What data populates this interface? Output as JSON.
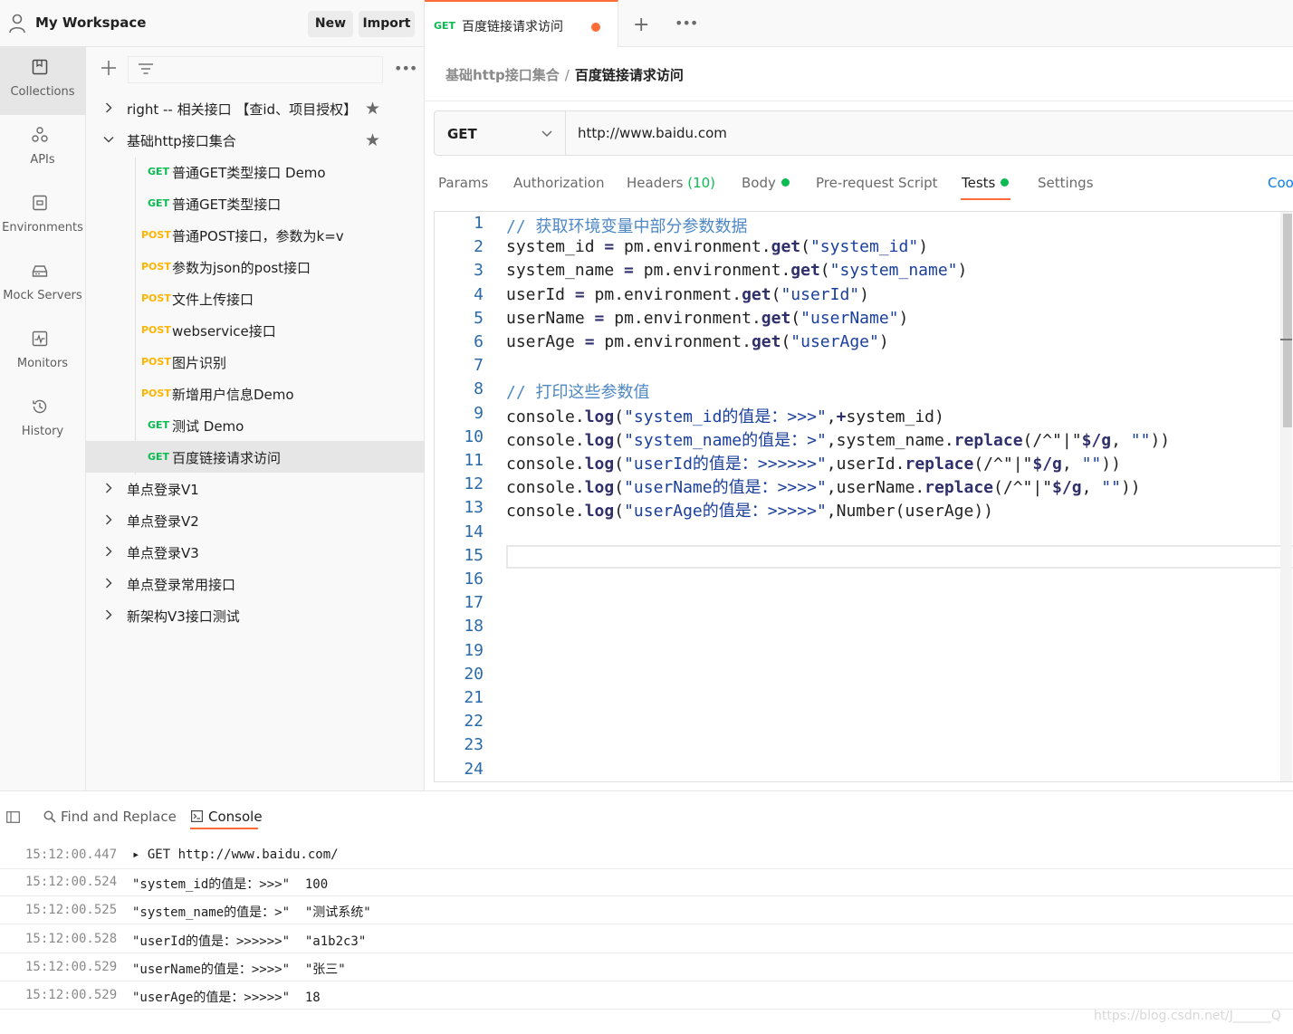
{
  "workspace": {
    "title": "My Workspace",
    "new_label": "New",
    "import_label": "Import"
  },
  "rail": [
    {
      "label": "Collections",
      "icon": "collections-icon",
      "active": true
    },
    {
      "label": "APIs",
      "icon": "apis-icon"
    },
    {
      "label": "Environments",
      "icon": "environments-icon"
    },
    {
      "label": "Mock Servers",
      "icon": "mock-servers-icon"
    },
    {
      "label": "Monitors",
      "icon": "monitors-icon"
    },
    {
      "label": "History",
      "icon": "history-icon"
    }
  ],
  "tree": {
    "items": [
      {
        "type": "folder",
        "label": "right -- 相关接口 【查id、项目授权】",
        "expanded": false,
        "starred": true
      },
      {
        "type": "folder",
        "label": "基础http接口集合",
        "expanded": true,
        "starred": true
      },
      {
        "type": "request",
        "method": "GET",
        "label": "普通GET类型接口 Demo"
      },
      {
        "type": "request",
        "method": "GET",
        "label": "普通GET类型接口"
      },
      {
        "type": "request",
        "method": "POST",
        "label": "普通POST接口，参数为k=v"
      },
      {
        "type": "request",
        "method": "POST",
        "label": "参数为json的post接口"
      },
      {
        "type": "request",
        "method": "POST",
        "label": "文件上传接口"
      },
      {
        "type": "request",
        "method": "POST",
        "label": "webservice接口"
      },
      {
        "type": "request",
        "method": "POST",
        "label": "图片识别"
      },
      {
        "type": "request",
        "method": "POST",
        "label": "新增用户信息Demo"
      },
      {
        "type": "request",
        "method": "GET",
        "label": "测试 Demo"
      },
      {
        "type": "request",
        "method": "GET",
        "label": "百度链接请求访问",
        "selected": true
      },
      {
        "type": "folder",
        "label": "单点登录V1",
        "expanded": false
      },
      {
        "type": "folder",
        "label": "单点登录V2",
        "expanded": false
      },
      {
        "type": "folder",
        "label": "单点登录V3",
        "expanded": false
      },
      {
        "type": "folder",
        "label": "单点登录常用接口",
        "expanded": false
      },
      {
        "type": "folder",
        "label": "新架构V3接口测试",
        "expanded": false
      }
    ]
  },
  "tab": {
    "method": "GET",
    "title": "百度链接请求访问",
    "unsaved": true
  },
  "breadcrumb": {
    "parent": "基础http接口集合",
    "separator": "/",
    "current": "百度链接请求访问"
  },
  "request": {
    "method": "GET",
    "url": "http://www.baidu.com"
  },
  "request_tabs": {
    "params": "Params",
    "authorization": "Authorization",
    "headers": "Headers",
    "headers_count": "(10)",
    "body": "Body",
    "pre_request": "Pre-request Script",
    "tests": "Tests",
    "settings": "Settings",
    "cookies": "Coo",
    "active": "Tests"
  },
  "editor": {
    "line_numbers": [
      "1",
      "2",
      "3",
      "4",
      "5",
      "6",
      "7",
      "8",
      "9",
      "10",
      "11",
      "12",
      "13",
      "14",
      "15",
      "16",
      "17",
      "18",
      "19",
      "20",
      "21",
      "22",
      "23",
      "24"
    ],
    "lines": [
      [
        [
          "cm",
          "// 获取环境变量中部分参数数据"
        ]
      ],
      [
        [
          "id",
          "system_id "
        ],
        [
          "kw",
          "="
        ],
        [
          "id",
          " pm.environment."
        ],
        [
          "kw",
          "get"
        ],
        [
          "id",
          "("
        ],
        [
          "str",
          "\"system_id\""
        ],
        [
          "id",
          ")"
        ]
      ],
      [
        [
          "id",
          "system_name "
        ],
        [
          "kw",
          "="
        ],
        [
          "id",
          " pm.environment."
        ],
        [
          "kw",
          "get"
        ],
        [
          "id",
          "("
        ],
        [
          "str",
          "\"system_name\""
        ],
        [
          "id",
          ")"
        ]
      ],
      [
        [
          "id",
          "userId "
        ],
        [
          "kw",
          "="
        ],
        [
          "id",
          " pm.environment."
        ],
        [
          "kw",
          "get"
        ],
        [
          "id",
          "("
        ],
        [
          "str",
          "\"userId\""
        ],
        [
          "id",
          ")"
        ]
      ],
      [
        [
          "id",
          "userName "
        ],
        [
          "kw",
          "="
        ],
        [
          "id",
          " pm.environment."
        ],
        [
          "kw",
          "get"
        ],
        [
          "id",
          "("
        ],
        [
          "str",
          "\"userName\""
        ],
        [
          "id",
          ")"
        ]
      ],
      [
        [
          "id",
          "userAge "
        ],
        [
          "kw",
          "="
        ],
        [
          "id",
          " pm.environment."
        ],
        [
          "kw",
          "get"
        ],
        [
          "id",
          "("
        ],
        [
          "str",
          "\"userAge\""
        ],
        [
          "id",
          ")"
        ]
      ],
      [],
      [
        [
          "cm",
          "// 打印这些参数值"
        ]
      ],
      [
        [
          "id",
          "console."
        ],
        [
          "kw",
          "log"
        ],
        [
          "id",
          "("
        ],
        [
          "str",
          "\"system_id的值是：>>>\""
        ],
        [
          "id",
          ","
        ],
        [
          "kw",
          "+"
        ],
        [
          "id",
          "system_id)"
        ]
      ],
      [
        [
          "id",
          "console."
        ],
        [
          "kw",
          "log"
        ],
        [
          "id",
          "("
        ],
        [
          "str",
          "\"system_name的值是：>\""
        ],
        [
          "id",
          ",system_name."
        ],
        [
          "kw",
          "replace"
        ],
        [
          "id",
          "(/^\"|\""
        ],
        [
          "kw",
          "$/g"
        ],
        [
          "id",
          ", "
        ],
        [
          "str",
          "\"\""
        ],
        [
          "id",
          "))"
        ]
      ],
      [
        [
          "id",
          "console."
        ],
        [
          "kw",
          "log"
        ],
        [
          "id",
          "("
        ],
        [
          "str",
          "\"userId的值是：>>>>>>\""
        ],
        [
          "id",
          ",userId."
        ],
        [
          "kw",
          "replace"
        ],
        [
          "id",
          "(/^\"|\""
        ],
        [
          "kw",
          "$/g"
        ],
        [
          "id",
          ", "
        ],
        [
          "str",
          "\"\""
        ],
        [
          "id",
          "))"
        ]
      ],
      [
        [
          "id",
          "console."
        ],
        [
          "kw",
          "log"
        ],
        [
          "id",
          "("
        ],
        [
          "str",
          "\"userName的值是：>>>>\""
        ],
        [
          "id",
          ",userName."
        ],
        [
          "kw",
          "replace"
        ],
        [
          "id",
          "(/^\"|\""
        ],
        [
          "kw",
          "$/g"
        ],
        [
          "id",
          ", "
        ],
        [
          "str",
          "\"\""
        ],
        [
          "id",
          "))"
        ]
      ],
      [
        [
          "id",
          "console."
        ],
        [
          "kw",
          "log"
        ],
        [
          "id",
          "("
        ],
        [
          "str",
          "\"userAge的值是：>>>>>\""
        ],
        [
          "id",
          ",Number(userAge))"
        ]
      ]
    ]
  },
  "console": {
    "find_replace": "Find and Replace",
    "console_label": "Console",
    "logs": [
      {
        "time": "15:12:00.447",
        "message": "▸ GET http://www.baidu.com/"
      },
      {
        "time": "15:12:00.524",
        "message": "\"system_id的值是：>>>\"  100"
      },
      {
        "time": "15:12:00.525",
        "message": "\"system_name的值是：>\"  \"测试系统\""
      },
      {
        "time": "15:12:00.528",
        "message": "\"userId的值是：>>>>>>\"  \"a1b2c3\""
      },
      {
        "time": "15:12:00.529",
        "message": "\"userName的值是：>>>>\"  \"张三\""
      },
      {
        "time": "15:12:00.529",
        "message": "\"userAge的值是：>>>>>\"  18"
      }
    ]
  },
  "watermark": "https://blog.csdn.net/J______Q",
  "colors": {
    "accent": "#ff6c37",
    "get": "#0cbb52",
    "post": "#ffb400",
    "link": "#097bed"
  }
}
